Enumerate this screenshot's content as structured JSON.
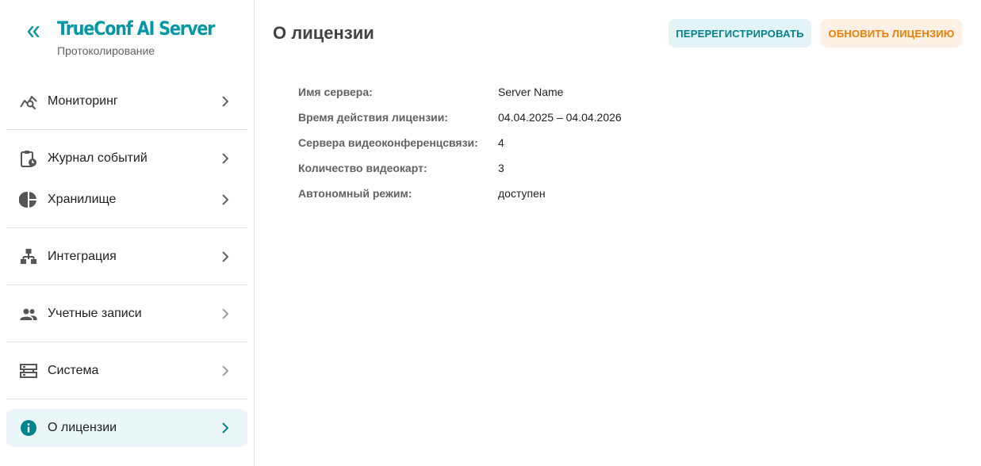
{
  "brand": {
    "logo_text": "TrueConf AI Server",
    "subtitle": "Протоколирование",
    "accent_color": "#0097a7"
  },
  "sidebar": {
    "items": [
      {
        "label": "Мониторинг",
        "icon": "monitoring-chart-icon"
      },
      {
        "label": "Журнал событий",
        "icon": "clipboard-clock-icon"
      },
      {
        "label": "Хранилище",
        "icon": "pie-chart-icon"
      },
      {
        "label": "Интеграция",
        "icon": "hierarchy-icon"
      },
      {
        "label": "Учетные записи",
        "icon": "people-icon"
      },
      {
        "label": "Система",
        "icon": "server-icon"
      },
      {
        "label": "О лицензии",
        "icon": "info-icon",
        "active": true
      }
    ]
  },
  "main": {
    "title": "О лицензии",
    "buttons": {
      "reregister": "ПЕРЕРЕГИСТРИРОВАТЬ",
      "update_license": "ОБНОВИТЬ ЛИЦЕНЗИЮ"
    },
    "info": [
      {
        "key": "Имя сервера:",
        "value": "Server Name"
      },
      {
        "key": "Время действия лицензии:",
        "value": "04.04.2025 – 04.04.2026"
      },
      {
        "key": "Сервера видеоконференцсвязи:",
        "value": "4"
      },
      {
        "key": "Количество видеокарт:",
        "value": "3"
      },
      {
        "key": "Автономный режим:",
        "value": "доступен"
      }
    ]
  },
  "colors": {
    "accent": "#0097a7",
    "reregister_bg": "#e3f3f6",
    "update_bg": "#fdf1e5",
    "update_text": "#ef7d00",
    "active_bg": "#eaf6f8"
  }
}
